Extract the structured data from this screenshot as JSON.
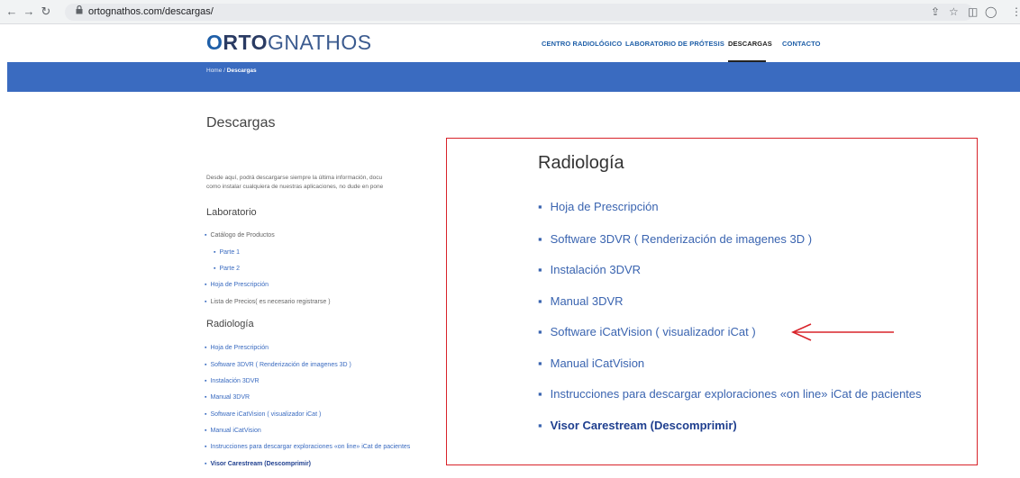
{
  "browser": {
    "url": "ortognathos.com/descargas/"
  },
  "site": {
    "logo_o": "O",
    "logo_bold": "RTO",
    "logo_light": "GNATHOS",
    "nav": [
      "CENTRO RADIOLÓGICO",
      "LABORATORIO DE PRÓTESIS",
      "DESCARGAS",
      "CONTACTO"
    ],
    "active_nav": "DESCARGAS",
    "breadcrumb_home": "Home",
    "breadcrumb_sep": " / ",
    "breadcrumb_current": "Descargas",
    "accent_color": "#3a6bc0"
  },
  "page": {
    "title": "Descargas",
    "intro_line1": "Desde aquí, podrá descargarse siempre la última información, docu",
    "intro_line2": "como instalar cualquiera de nuestras aplicaciones, no dude en pone",
    "laboratorio": {
      "heading": "Laboratorio",
      "items": [
        "Catálogo de Productos",
        "Parte 1",
        "Parte 2",
        "Hoja de Prescripción",
        "Lista de Precios( es necesario registrarse )"
      ]
    },
    "radiologia": {
      "heading": "Radiología",
      "items": [
        "Hoja de Prescripción",
        "Software 3DVR ( Renderización de imagenes 3D )",
        "Instalación 3DVR",
        "Manual 3DVR",
        "Software iCatVision ( visualizador iCat )",
        "Manual iCatVision",
        "Instrucciones para descargar exploraciones «on line» iCat de pacientes",
        "Visor Carestream (Descomprimir)"
      ]
    }
  },
  "zoom": {
    "heading": "Radiología",
    "items": [
      "Hoja de Prescripción",
      "Software 3DVR ( Renderización de imagenes 3D )",
      "Instalación 3DVR",
      "Manual 3DVR",
      "Software iCatVision ( visualizador iCat )",
      "Manual iCatVision",
      "Instrucciones para descargar exploraciones «on line» iCat de pacientes",
      "Visor Carestream (Descomprimir)"
    ],
    "highlight_color": "#d8232a",
    "arrow_target": "Software iCatVision ( visualizador iCat )"
  },
  "icons": {
    "back": "back-arrow-icon",
    "forward": "forward-arrow-icon",
    "reload": "reload-icon",
    "lock": "lock-icon",
    "share": "share-icon",
    "star": "star-icon",
    "sidebar": "sidebar-icon",
    "profile": "profile-icon",
    "menu": "kebab-menu-icon",
    "arrow": "red-arrow-icon"
  }
}
